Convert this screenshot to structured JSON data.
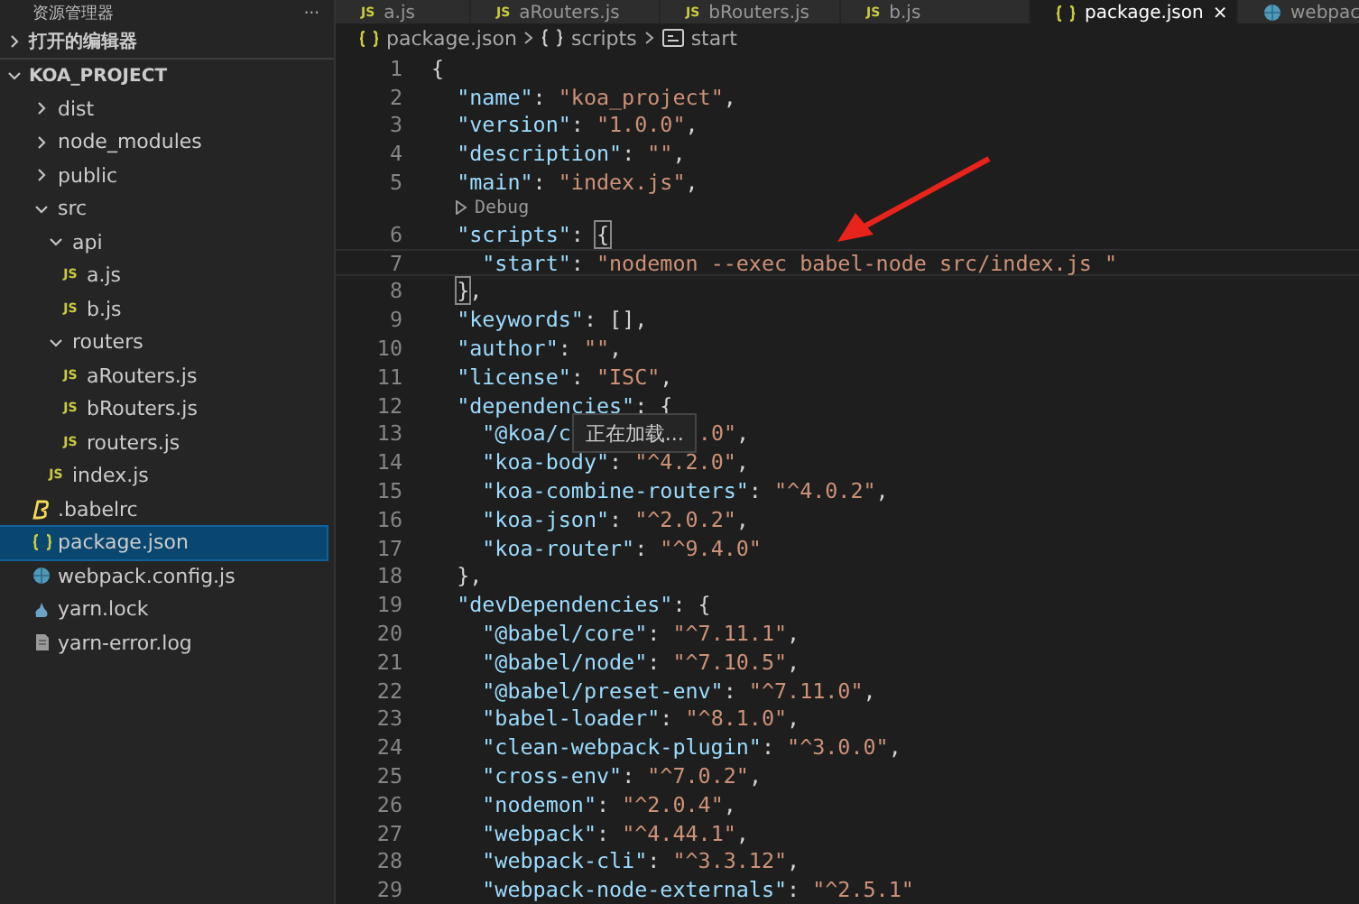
{
  "sidebar": {
    "title": "资源管理器",
    "more": "···",
    "sections": [
      {
        "label": "打开的编辑器",
        "expanded": false
      },
      {
        "label": "KOA_PROJECT",
        "expanded": true
      }
    ],
    "tree": [
      {
        "label": "dist",
        "kind": "folder",
        "expanded": false,
        "selected": false
      },
      {
        "label": "node_modules",
        "kind": "folder",
        "expanded": false,
        "selected": false
      },
      {
        "label": "public",
        "kind": "folder",
        "expanded": false,
        "selected": false
      },
      {
        "label": "src",
        "kind": "folder",
        "expanded": true,
        "selected": false,
        "children": [
          {
            "label": "api",
            "kind": "folder",
            "expanded": true,
            "selected": false,
            "children": [
              {
                "label": "a.js",
                "kind": "js",
                "icon_text": "JS",
                "selected": false
              },
              {
                "label": "b.js",
                "kind": "js",
                "icon_text": "JS",
                "selected": false
              }
            ]
          },
          {
            "label": "routers",
            "kind": "folder",
            "expanded": true,
            "selected": false,
            "children": [
              {
                "label": "aRouters.js",
                "kind": "js",
                "icon_text": "JS",
                "selected": false
              },
              {
                "label": "bRouters.js",
                "kind": "js",
                "icon_text": "JS",
                "selected": false
              },
              {
                "label": "routers.js",
                "kind": "js",
                "icon_text": "JS",
                "selected": false
              }
            ]
          },
          {
            "label": "index.js",
            "kind": "js",
            "icon_text": "JS",
            "selected": false
          }
        ]
      },
      {
        "label": ".babelrc",
        "kind": "babel",
        "selected": false
      },
      {
        "label": "package.json",
        "kind": "json",
        "selected": true
      },
      {
        "label": "webpack.config.js",
        "kind": "webpack",
        "selected": false
      },
      {
        "label": "yarn.lock",
        "kind": "yarn",
        "selected": false
      },
      {
        "label": "yarn-error.log",
        "kind": "log",
        "selected": false
      }
    ]
  },
  "tabs": [
    {
      "label": "a.js",
      "kind": "js",
      "icon_text": "JS",
      "selected": false
    },
    {
      "label": "aRouters.js",
      "kind": "js",
      "icon_text": "JS",
      "selected": false
    },
    {
      "label": "bRouters.js",
      "kind": "js",
      "icon_text": "JS",
      "selected": false
    },
    {
      "label": "b.js",
      "kind": "js",
      "icon_text": "JS",
      "selected": false
    },
    {
      "label": "package.json",
      "kind": "json",
      "selected": true,
      "close": "×"
    },
    {
      "label": "webpac",
      "kind": "webpack",
      "selected": false
    }
  ],
  "breadcrumb": [
    {
      "label": "package.json",
      "kind": "json"
    },
    {
      "label": "scripts",
      "kind": "object"
    },
    {
      "label": "start",
      "kind": "property"
    }
  ],
  "lines": [
    {
      "kind": "code",
      "number": "1",
      "tokens": [
        {
          "kind": "punct",
          "text": "{"
        }
      ]
    },
    {
      "kind": "code",
      "number": "2",
      "tokens": [
        {
          "kind": "key",
          "text": "  \"name\""
        },
        {
          "kind": "punct",
          "text": ": "
        },
        {
          "kind": "string",
          "text": "\"koa_project\""
        },
        {
          "kind": "punct",
          "text": ","
        }
      ]
    },
    {
      "kind": "code",
      "number": "3",
      "tokens": [
        {
          "kind": "key",
          "text": "  \"version\""
        },
        {
          "kind": "punct",
          "text": ": "
        },
        {
          "kind": "string",
          "text": "\"1.0.0\""
        },
        {
          "kind": "punct",
          "text": ","
        }
      ]
    },
    {
      "kind": "code",
      "number": "4",
      "tokens": [
        {
          "kind": "key",
          "text": "  \"description\""
        },
        {
          "kind": "punct",
          "text": ": "
        },
        {
          "kind": "string",
          "text": "\"\""
        },
        {
          "kind": "punct",
          "text": ","
        }
      ]
    },
    {
      "kind": "code",
      "number": "5",
      "tokens": [
        {
          "kind": "key",
          "text": "  \"main\""
        },
        {
          "kind": "punct",
          "text": ": "
        },
        {
          "kind": "string",
          "text": "\"index.js\""
        },
        {
          "kind": "punct",
          "text": ","
        }
      ]
    },
    {
      "kind": "codelens",
      "text": "Debug"
    },
    {
      "kind": "code",
      "number": "6",
      "tokens": [
        {
          "kind": "key",
          "text": "  \"scripts\""
        },
        {
          "kind": "punct",
          "text": ": "
        },
        {
          "kind": "bracket",
          "text": "{"
        }
      ]
    },
    {
      "kind": "code",
      "number": "7",
      "current": true,
      "tokens": [
        {
          "kind": "key",
          "text": "    \"start\""
        },
        {
          "kind": "punct",
          "text": ": "
        },
        {
          "kind": "string",
          "text": "\"nodemon --exec babel-node src/index.js \""
        }
      ]
    },
    {
      "kind": "close",
      "number": "8",
      "tokens": [
        {
          "kind": "bracket",
          "text": "}"
        },
        {
          "kind": "punct",
          "text": ","
        }
      ]
    },
    {
      "kind": "code",
      "number": "9",
      "tokens": [
        {
          "kind": "key",
          "text": "  \"keywords\""
        },
        {
          "kind": "punct",
          "text": ": [],"
        }
      ]
    },
    {
      "kind": "code",
      "number": "10",
      "tokens": [
        {
          "kind": "key",
          "text": "  \"author\""
        },
        {
          "kind": "punct",
          "text": ": "
        },
        {
          "kind": "string",
          "text": "\"\""
        },
        {
          "kind": "punct",
          "text": ","
        }
      ]
    },
    {
      "kind": "code",
      "number": "11",
      "tokens": [
        {
          "kind": "key",
          "text": "  \"license\""
        },
        {
          "kind": "punct",
          "text": ": "
        },
        {
          "kind": "string",
          "text": "\"ISC\""
        },
        {
          "kind": "punct",
          "text": ","
        }
      ]
    },
    {
      "kind": "code",
      "number": "12",
      "tokens": [
        {
          "kind": "key",
          "text": "  \"dependencies\""
        },
        {
          "kind": "punct",
          "text": ": {"
        }
      ]
    },
    {
      "kind": "code",
      "number": "13",
      "tokens": [
        {
          "kind": "key",
          "text": "    \"@koa/c"
        },
        {
          "kind": "popup",
          "text": "正在加载..."
        },
        {
          "kind": "string",
          "text": ".0\""
        },
        {
          "kind": "punct",
          "text": ","
        }
      ]
    },
    {
      "kind": "code",
      "number": "14",
      "tokens": [
        {
          "kind": "key",
          "text": "    \"koa-body\""
        },
        {
          "kind": "punct",
          "text": ": "
        },
        {
          "kind": "string",
          "text": "\"^4.2.0\""
        },
        {
          "kind": "punct",
          "text": ","
        }
      ]
    },
    {
      "kind": "code",
      "number": "15",
      "tokens": [
        {
          "kind": "key",
          "text": "    \"koa-combine-routers\""
        },
        {
          "kind": "punct",
          "text": ": "
        },
        {
          "kind": "string",
          "text": "\"^4.0.2\""
        },
        {
          "kind": "punct",
          "text": ","
        }
      ]
    },
    {
      "kind": "code",
      "number": "16",
      "tokens": [
        {
          "kind": "key",
          "text": "    \"koa-json\""
        },
        {
          "kind": "punct",
          "text": ": "
        },
        {
          "kind": "string",
          "text": "\"^2.0.2\""
        },
        {
          "kind": "punct",
          "text": ","
        }
      ]
    },
    {
      "kind": "code",
      "number": "17",
      "tokens": [
        {
          "kind": "key",
          "text": "    \"koa-router\""
        },
        {
          "kind": "punct",
          "text": ": "
        },
        {
          "kind": "string",
          "text": "\"^9.4.0\""
        }
      ]
    },
    {
      "kind": "code",
      "number": "18",
      "tokens": [
        {
          "kind": "punct",
          "text": "  },"
        }
      ]
    },
    {
      "kind": "code",
      "number": "19",
      "tokens": [
        {
          "kind": "key",
          "text": "  \"devDependencies\""
        },
        {
          "kind": "punct",
          "text": ": {"
        }
      ]
    },
    {
      "kind": "code",
      "number": "20",
      "tokens": [
        {
          "kind": "key",
          "text": "    \"@babel/core\""
        },
        {
          "kind": "punct",
          "text": ": "
        },
        {
          "kind": "string",
          "text": "\"^7.11.1\""
        },
        {
          "kind": "punct",
          "text": ","
        }
      ]
    },
    {
      "kind": "code",
      "number": "21",
      "tokens": [
        {
          "kind": "key",
          "text": "    \"@babel/node\""
        },
        {
          "kind": "punct",
          "text": ": "
        },
        {
          "kind": "string",
          "text": "\"^7.10.5\""
        },
        {
          "kind": "punct",
          "text": ","
        }
      ]
    },
    {
      "kind": "code",
      "number": "22",
      "tokens": [
        {
          "kind": "key",
          "text": "    \"@babel/preset-env\""
        },
        {
          "kind": "punct",
          "text": ": "
        },
        {
          "kind": "string",
          "text": "\"^7.11.0\""
        },
        {
          "kind": "punct",
          "text": ","
        }
      ]
    },
    {
      "kind": "code",
      "number": "23",
      "tokens": [
        {
          "kind": "key",
          "text": "    \"babel-loader\""
        },
        {
          "kind": "punct",
          "text": ": "
        },
        {
          "kind": "string",
          "text": "\"^8.1.0\""
        },
        {
          "kind": "punct",
          "text": ","
        }
      ]
    },
    {
      "kind": "code",
      "number": "24",
      "tokens": [
        {
          "kind": "key",
          "text": "    \"clean-webpack-plugin\""
        },
        {
          "kind": "punct",
          "text": ": "
        },
        {
          "kind": "string",
          "text": "\"^3.0.0\""
        },
        {
          "kind": "punct",
          "text": ","
        }
      ]
    },
    {
      "kind": "code",
      "number": "25",
      "tokens": [
        {
          "kind": "key",
          "text": "    \"cross-env\""
        },
        {
          "kind": "punct",
          "text": ": "
        },
        {
          "kind": "string",
          "text": "\"^7.0.2\""
        },
        {
          "kind": "punct",
          "text": ","
        }
      ]
    },
    {
      "kind": "code",
      "number": "26",
      "tokens": [
        {
          "kind": "key",
          "text": "    \"nodemon\""
        },
        {
          "kind": "punct",
          "text": ": "
        },
        {
          "kind": "string",
          "text": "\"^2.0.4\""
        },
        {
          "kind": "punct",
          "text": ","
        }
      ]
    },
    {
      "kind": "code",
      "number": "27",
      "tokens": [
        {
          "kind": "key",
          "text": "    \"webpack\""
        },
        {
          "kind": "punct",
          "text": ": "
        },
        {
          "kind": "string",
          "text": "\"^4.44.1\""
        },
        {
          "kind": "punct",
          "text": ","
        }
      ]
    },
    {
      "kind": "code",
      "number": "28",
      "tokens": [
        {
          "kind": "key",
          "text": "    \"webpack-cli\""
        },
        {
          "kind": "punct",
          "text": ": "
        },
        {
          "kind": "string",
          "text": "\"^3.3.12\""
        },
        {
          "kind": "punct",
          "text": ","
        }
      ]
    },
    {
      "kind": "code",
      "number": "29",
      "tokens": [
        {
          "kind": "key",
          "text": "    \"webpack-node-externals\""
        },
        {
          "kind": "punct",
          "text": ": "
        },
        {
          "kind": "string",
          "text": "\"^2.5.1\""
        }
      ]
    }
  ]
}
